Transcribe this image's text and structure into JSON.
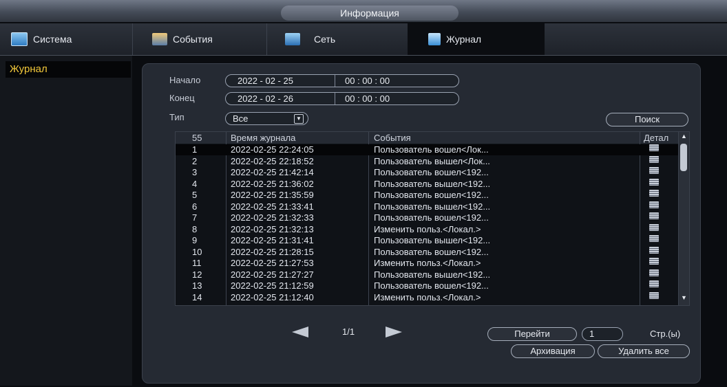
{
  "window": {
    "title": "Информация"
  },
  "tabs": [
    {
      "label": "Система",
      "icon": "monitor-icon"
    },
    {
      "label": "События",
      "icon": "events-icon"
    },
    {
      "label": "Сеть",
      "icon": "network-icon"
    },
    {
      "label": "Журнал",
      "icon": "journal-icon",
      "active": true
    }
  ],
  "sidebar": {
    "items": [
      {
        "label": "Журнал",
        "selected": true
      }
    ]
  },
  "filters": {
    "start_label": "Начало",
    "start_date": "2022 - 02 - 25",
    "start_time": "00 : 00 : 00",
    "end_label": "Конец",
    "end_date": "2022 - 02 - 26",
    "end_time": "00 : 00 : 00",
    "type_label": "Тип",
    "type_value": "Все",
    "search_label": "Поиск"
  },
  "table": {
    "headers": {
      "count": "55",
      "time": "Время журнала",
      "event": "События",
      "detail": "Детал"
    },
    "rows": [
      {
        "n": "1",
        "time": "2022-02-25 22:24:05",
        "event": "Пользователь вошел<Лок..."
      },
      {
        "n": "2",
        "time": "2022-02-25 22:18:52",
        "event": "Пользователь вышел<Лок..."
      },
      {
        "n": "3",
        "time": "2022-02-25 21:42:14",
        "event": "Пользователь вошел<192..."
      },
      {
        "n": "4",
        "time": "2022-02-25 21:36:02",
        "event": "Пользователь вышел<192..."
      },
      {
        "n": "5",
        "time": "2022-02-25 21:35:59",
        "event": "Пользователь вошел<192..."
      },
      {
        "n": "6",
        "time": "2022-02-25 21:33:41",
        "event": "Пользователь вышел<192..."
      },
      {
        "n": "7",
        "time": "2022-02-25 21:32:33",
        "event": "Пользователь вошел<192..."
      },
      {
        "n": "8",
        "time": "2022-02-25 21:32:13",
        "event": "Изменить польз.<Локал.>"
      },
      {
        "n": "9",
        "time": "2022-02-25 21:31:41",
        "event": "Пользователь вышел<192..."
      },
      {
        "n": "10",
        "time": "2022-02-25 21:28:15",
        "event": "Пользователь вошел<192..."
      },
      {
        "n": "11",
        "time": "2022-02-25 21:27:53",
        "event": "Изменить польз.<Локал.>"
      },
      {
        "n": "12",
        "time": "2022-02-25 21:27:27",
        "event": "Пользователь вышел<192..."
      },
      {
        "n": "13",
        "time": "2022-02-25 21:12:59",
        "event": "Пользователь вошел<192..."
      },
      {
        "n": "14",
        "time": "2022-02-25 21:12:40",
        "event": "Изменить польз.<Локал.>"
      }
    ]
  },
  "pager": {
    "page": "1/1",
    "goto_label": "Перейти",
    "page_input": "1",
    "pages_label": "Стр.(ы)"
  },
  "actions": {
    "backup_label": "Архивация",
    "delete_all_label": "Удалить все"
  },
  "colors": {
    "accent": "#f2c83a",
    "background": "#0a0c10"
  }
}
